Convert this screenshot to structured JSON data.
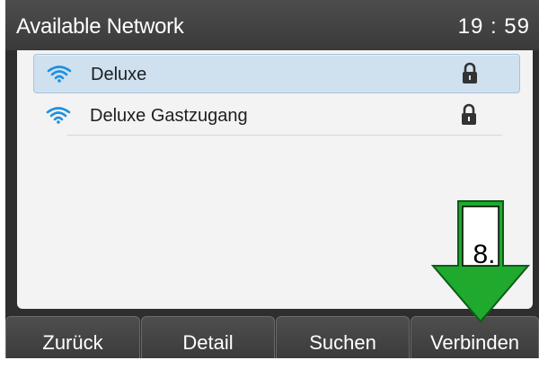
{
  "header": {
    "title": "Available Network",
    "clock": "19 : 59"
  },
  "networks": [
    {
      "ssid": "Deluxe",
      "selected": true,
      "secured": true,
      "icon": "wifi-icon",
      "lock_icon": "lock-icon"
    },
    {
      "ssid": "Deluxe Gastzugang",
      "selected": false,
      "secured": true,
      "icon": "wifi-icon",
      "lock_icon": "lock-icon"
    }
  ],
  "softkeys": [
    {
      "label": "Zurück"
    },
    {
      "label": "Detail"
    },
    {
      "label": "Suchen"
    },
    {
      "label": "Verbinden"
    }
  ],
  "annotation": {
    "step_label": "8.",
    "arrow_color": "#1faa2e",
    "icon": "down-arrow-icon"
  },
  "colors": {
    "wifi": "#1e90e0",
    "selected_row": "#cfe0ef",
    "titlebar": "#434343"
  }
}
